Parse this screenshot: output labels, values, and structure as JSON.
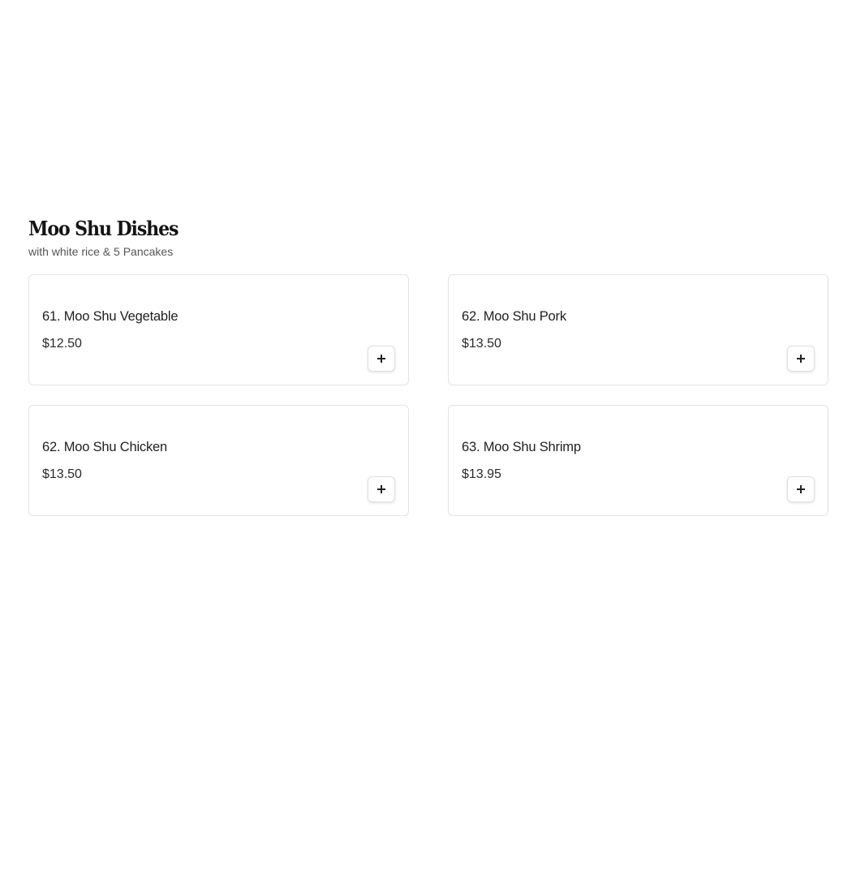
{
  "section": {
    "title": "Moo Shu Dishes",
    "subtitle": "with white rice & 5 Pancakes"
  },
  "items": [
    {
      "name": "61. Moo Shu Vegetable",
      "price": "$12.50",
      "add_icon": "plus-icon"
    },
    {
      "name": "62. Moo Shu Pork",
      "price": "$13.50",
      "add_icon": "plus-icon"
    },
    {
      "name": "62. Moo Shu Chicken",
      "price": "$13.50",
      "add_icon": "plus-icon"
    },
    {
      "name": "63. Moo Shu Shrimp",
      "price": "$13.95",
      "add_icon": "plus-icon"
    }
  ],
  "colors": {
    "background": "#ffffff",
    "card_border": "#e3e3e3",
    "title_text": "#141414",
    "subtitle_text": "#555555"
  }
}
